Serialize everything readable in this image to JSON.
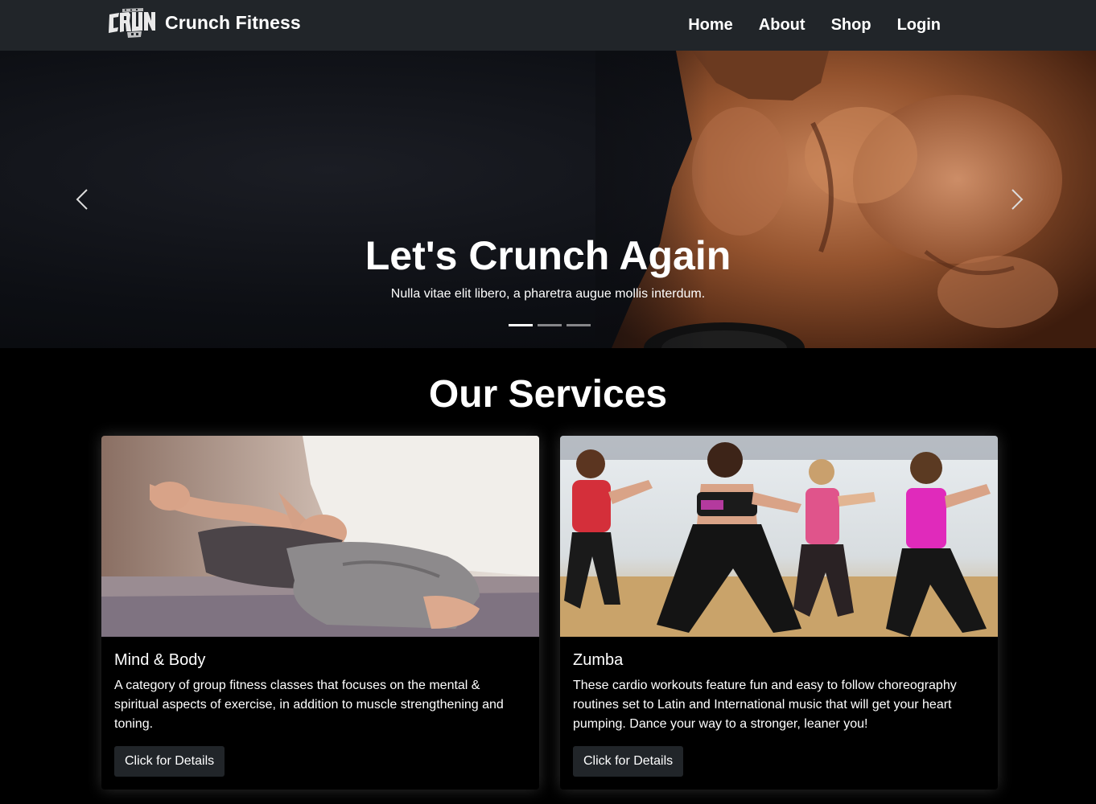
{
  "navbar": {
    "logo_text": "CRUNCH",
    "brand": "Crunch Fitness",
    "links": [
      {
        "label": "Home"
      },
      {
        "label": "About"
      },
      {
        "label": "Shop"
      },
      {
        "label": "Login"
      }
    ]
  },
  "hero": {
    "title": "Let's Crunch Again",
    "subtitle": "Nulla vitae elit libero, a pharetra augue mollis interdum.",
    "slide_count": 3,
    "active_slide": 1,
    "prev_icon": "chevron-left-icon",
    "next_icon": "chevron-right-icon"
  },
  "services": {
    "heading": "Our Services",
    "cards": [
      {
        "title": "Mind & Body",
        "text": "A category of group fitness classes that focuses on the mental & spiritual aspects of exercise, in addition to muscle strengthening and toning.",
        "button": "Click for Details"
      },
      {
        "title": "Zumba",
        "text": "These cardio workouts feature fun and easy to follow choreography routines set to Latin and International music that will get your heart pumping. Dance your way to a stronger, leaner you!",
        "button": "Click for Details"
      }
    ]
  },
  "colors": {
    "navbar_bg": "#212529",
    "page_bg": "#000000",
    "button_bg": "#212529",
    "text": "#ffffff"
  }
}
